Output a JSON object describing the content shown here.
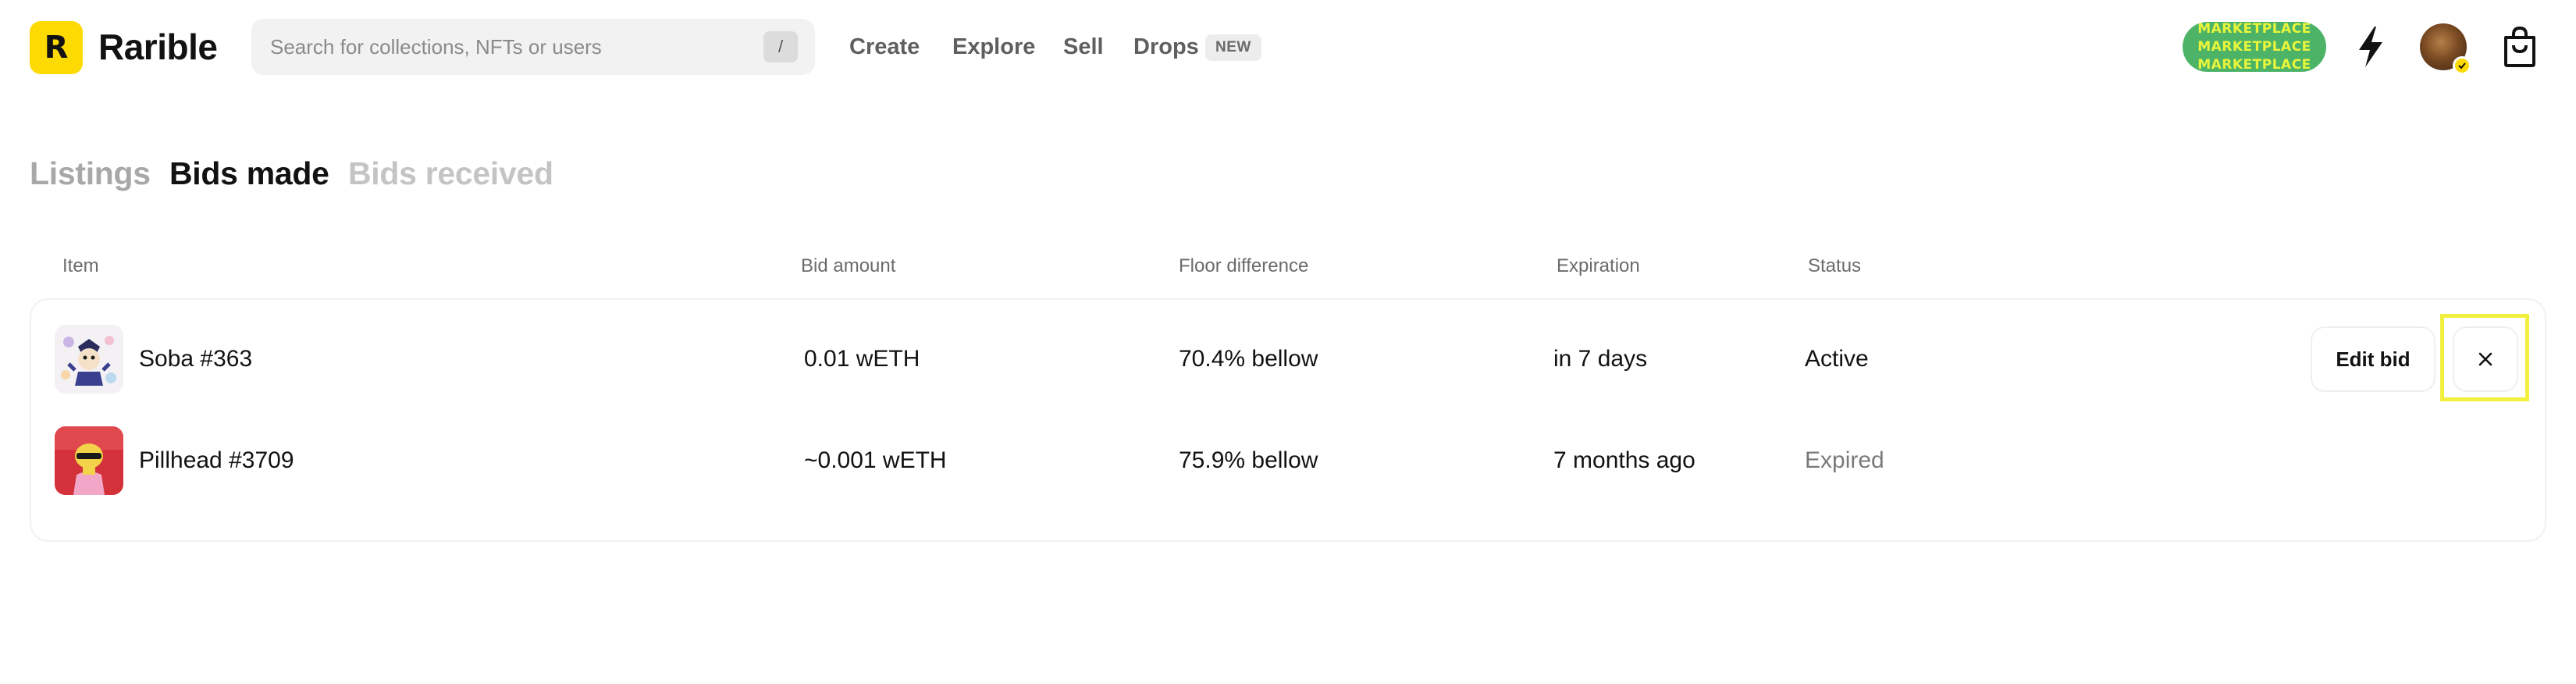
{
  "header": {
    "logo_letter": "R",
    "app_name": "Rarible",
    "search": {
      "placeholder": "Search for collections, NFTs or users",
      "shortcut": "/"
    },
    "nav": [
      {
        "label": "Create"
      },
      {
        "label": "Explore"
      },
      {
        "label": "Sell"
      },
      {
        "label": "Drops",
        "badge": "NEW"
      }
    ],
    "marketplace_badge": {
      "text": "MARKETPLACE",
      "color": "#4CB367",
      "text_color": "#E9F53B"
    },
    "icons": {
      "activity": "bolt-icon",
      "profile": "avatar",
      "cart": "bag-icon"
    }
  },
  "tabs": [
    {
      "label": "Listings",
      "state": "inactive"
    },
    {
      "label": "Bids made",
      "state": "active"
    },
    {
      "label": "Bids received",
      "state": "inactive"
    }
  ],
  "table": {
    "columns": [
      "Item",
      "Bid amount",
      "Floor difference",
      "Expiration",
      "Status"
    ],
    "rows": [
      {
        "item": "Soba #363",
        "bid_amount": "0.01 wETH",
        "floor_difference": "70.4% bellow",
        "expiration": "in 7 days",
        "status": "Active",
        "actions": {
          "edit": "Edit bid",
          "cancel_icon": "close-icon"
        }
      },
      {
        "item": "Pillhead #3709",
        "bid_amount": "~0.001 wETH",
        "floor_difference": "75.9% bellow",
        "expiration": "7 months ago",
        "status": "Expired"
      }
    ]
  },
  "colors": {
    "brand": "#FEDA03",
    "highlight": "#F2F03C"
  }
}
